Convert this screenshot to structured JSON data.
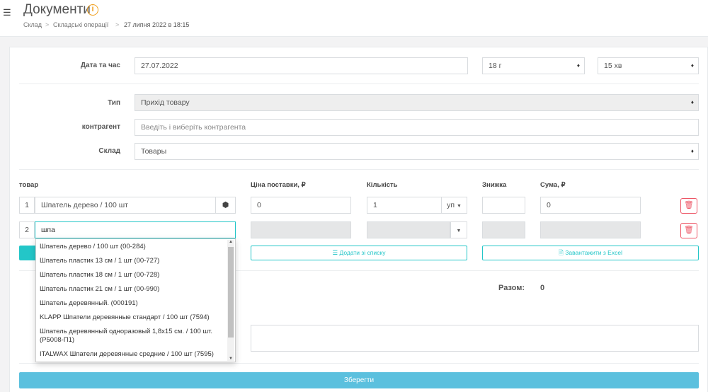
{
  "header": {
    "title": "Документи",
    "breadcrumb": [
      "Склад",
      "Складські операції",
      "27 липня 2022 в 18:15"
    ],
    "breadcrumb_sep": ">"
  },
  "form": {
    "date_label": "Дата та час",
    "date_value": "27.07.2022",
    "hour_value": "18 г",
    "minute_value": "15 хв",
    "type_label": "Тип",
    "type_value": "Прихід товару",
    "contractor_label": "контрагент",
    "contractor_placeholder": "Введіть і виберіть контрагента",
    "warehouse_label": "Склад",
    "warehouse_value": "Товары"
  },
  "table": {
    "headers": {
      "product": "товар",
      "price": "Ціна поставки, ₽",
      "qty": "Кількість",
      "discount": "Знижка",
      "sum": "Сума, ₽"
    },
    "rows": [
      {
        "num": "1",
        "product": "Шпатель дерево / 100 шт",
        "price": "0",
        "qty": "1",
        "unit": "уп",
        "discount": "",
        "sum": "0"
      },
      {
        "num": "2",
        "product": "шпа",
        "price": "",
        "qty": "",
        "unit": "",
        "discount": "",
        "sum": ""
      }
    ]
  },
  "buttons": {
    "add_from_list": "Додати зі списку",
    "upload_excel": "Завантажити з Excel",
    "save": "Зберегти"
  },
  "totals": {
    "label": "Разом:",
    "value": "0"
  },
  "dropdown": {
    "items": [
      "Шпатель дерево / 100 шт (00-284)",
      "Шпатель пластик 13 см / 1 шт (00-727)",
      "Шпатель пластик 18 см / 1 шт (00-728)",
      "Шпатель пластик 21 см / 1 шт (00-990)",
      "Шпатель деревянный. (000191)",
      "KLAPP Шпатели деревянные стандарт / 100 шт (7594)",
      "Шпатель деревянный одноразовый 1,8х15 см. / 100 шт. (Р5008-П1)",
      "ITALWAX Шпатели деревянные средние / 100 шт (7595)"
    ]
  },
  "colors": {
    "accent": "#23c6c8",
    "danger": "#ed5565",
    "save": "#5bc0de",
    "info": "#f0a020"
  }
}
